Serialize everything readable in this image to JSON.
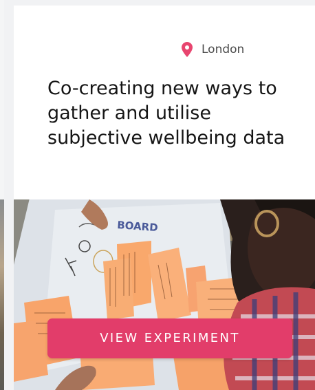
{
  "card": {
    "location": "London",
    "title": "Co-creating new ways to gather and utilise subjective wellbeing data",
    "cta_label": "VIEW EXPERIMENT",
    "photo_board_text": "BOARD"
  },
  "icons": {
    "location": "map-pin-icon"
  },
  "colors": {
    "accent": "#e23d6a",
    "pin": "#e8456f",
    "title_text": "#151515",
    "location_text": "#4a4a4a",
    "page_background": "#f1f2f4"
  }
}
